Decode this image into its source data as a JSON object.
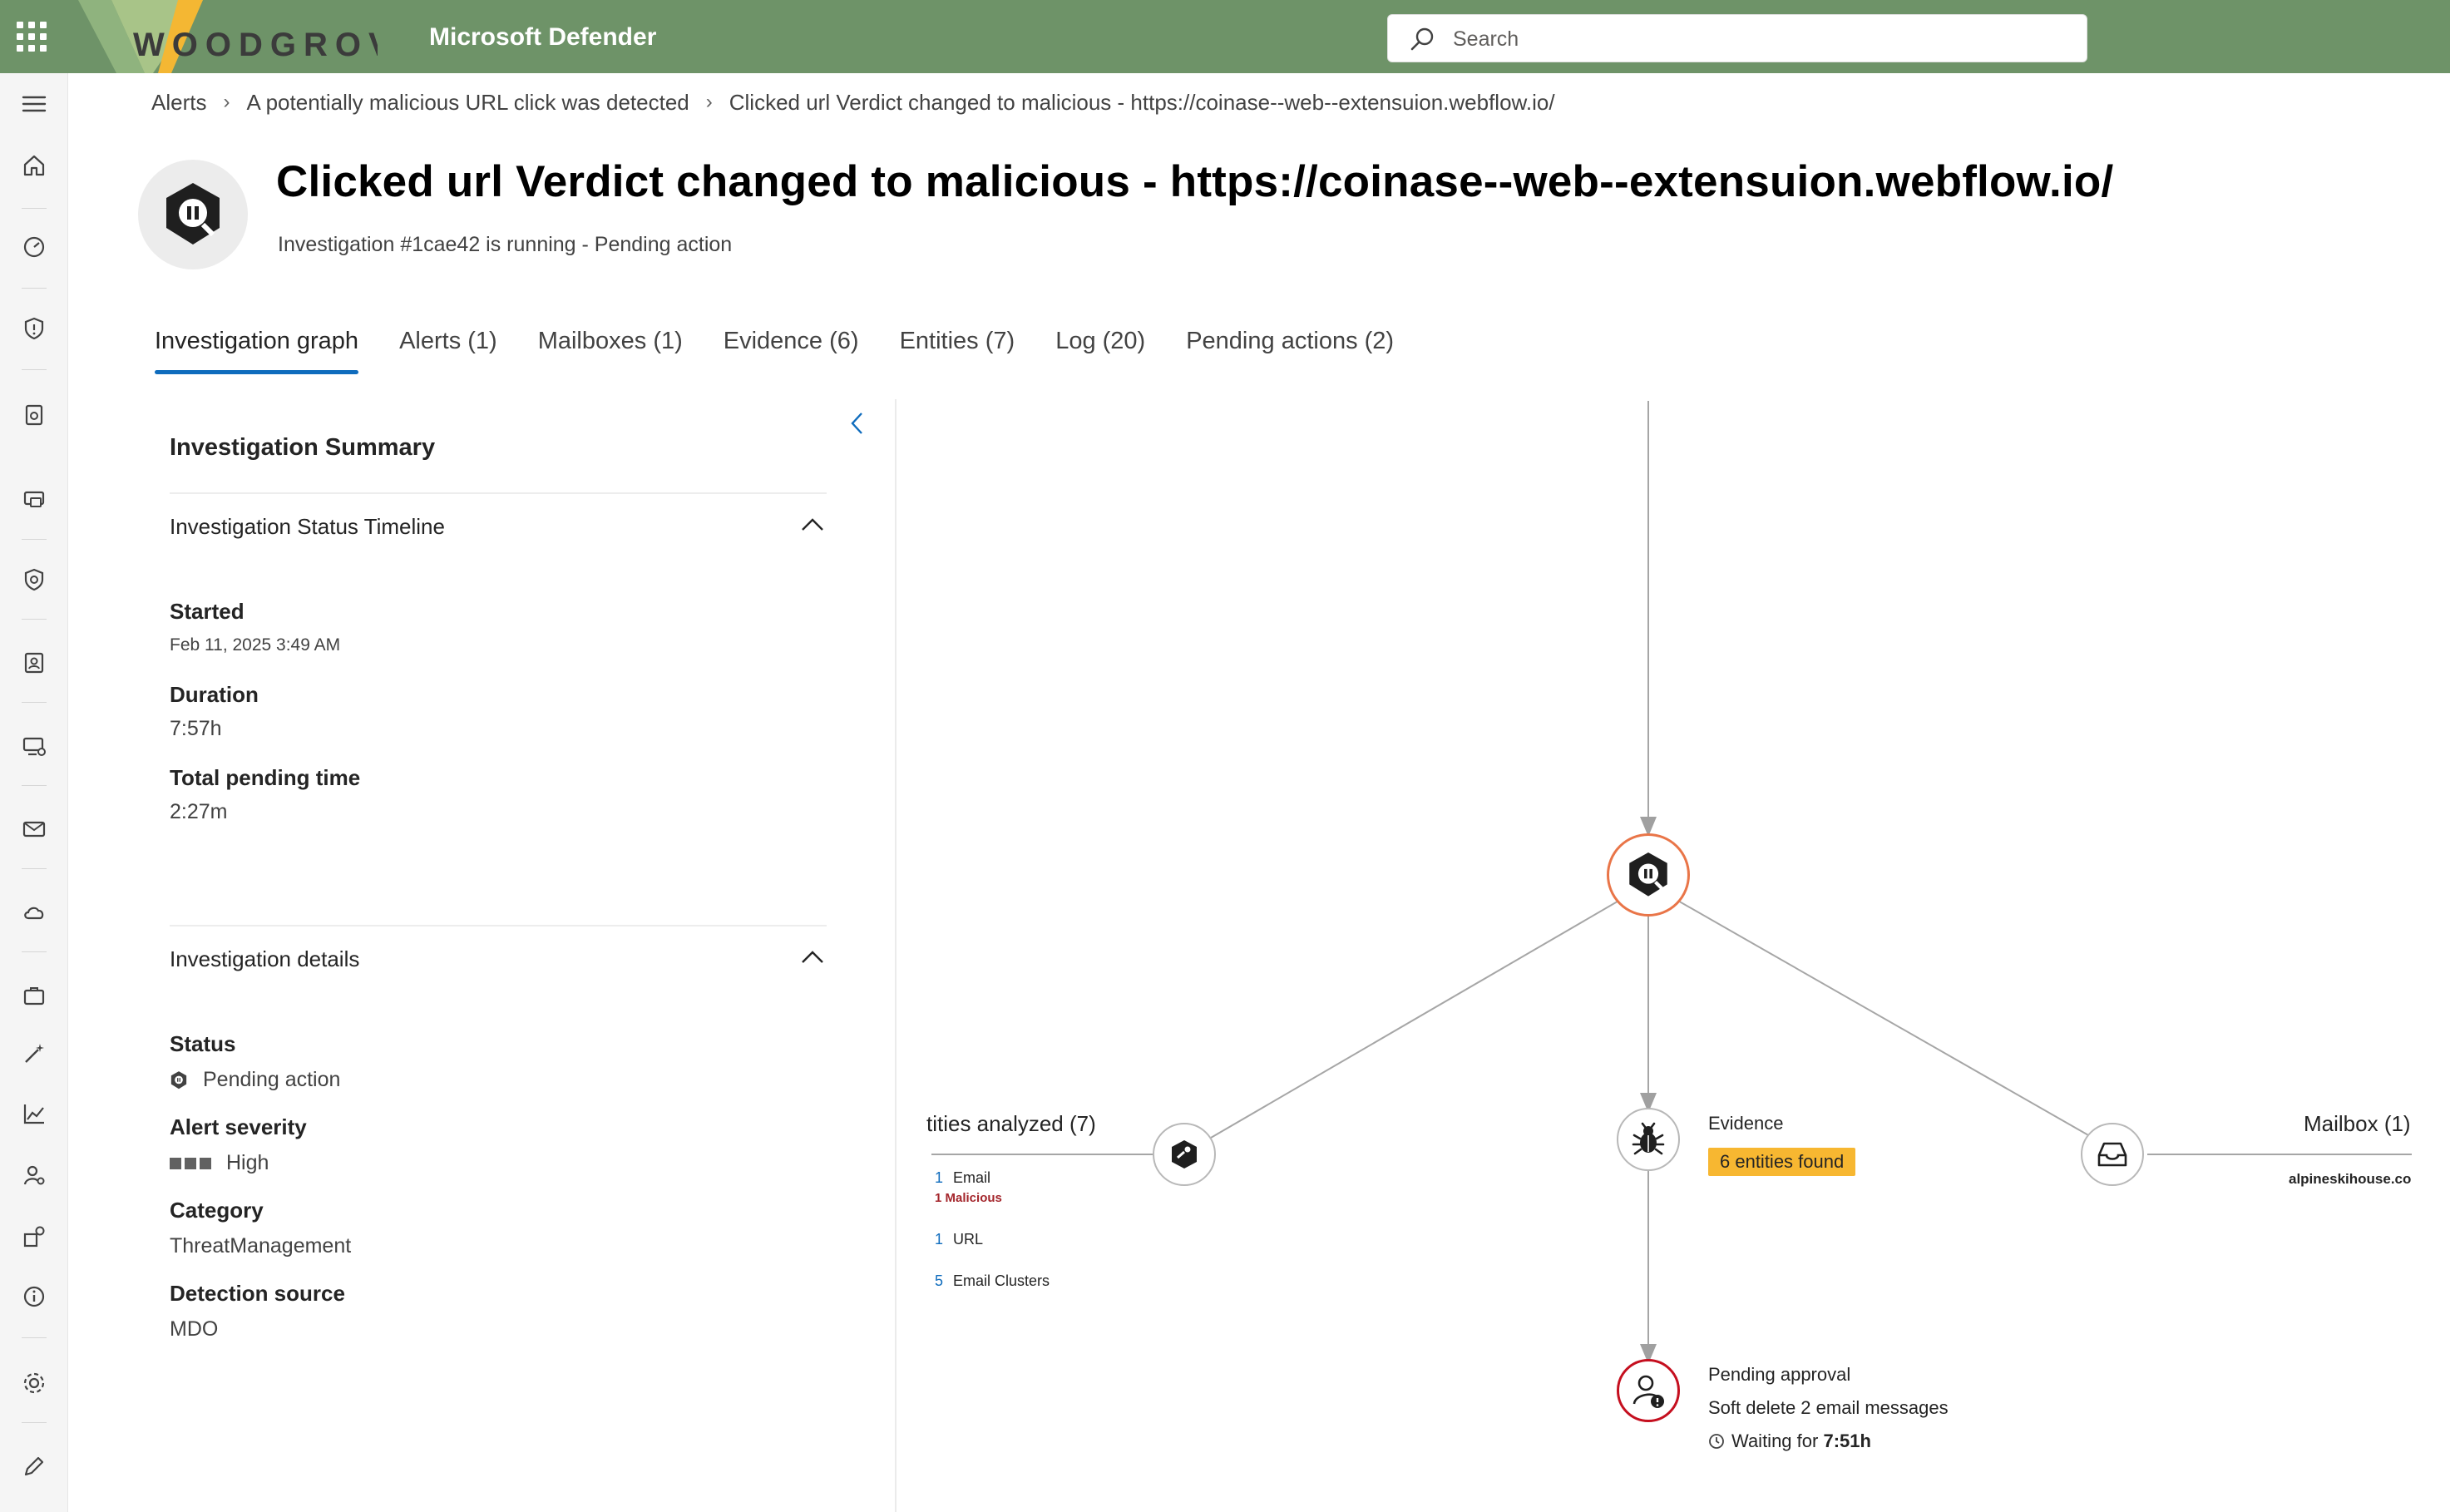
{
  "topbar": {
    "logo_text": "WOODGROVE",
    "product_name": "Microsoft Defender",
    "search_placeholder": "Search"
  },
  "breadcrumb": {
    "items": [
      "Alerts",
      "A potentially malicious URL click was detected",
      "Clicked url Verdict changed to malicious - https://coinase--web--extensuion.webflow.io/"
    ]
  },
  "header": {
    "title": "Clicked url Verdict changed to malicious - https://coinase--web--extensuion.webflow.io/",
    "subtitle": "Investigation #1cae42 is running - Pending action"
  },
  "tabs": [
    {
      "label": "Investigation graph",
      "active": true
    },
    {
      "label": "Alerts (1)",
      "active": false
    },
    {
      "label": "Mailboxes (1)",
      "active": false
    },
    {
      "label": "Evidence (6)",
      "active": false
    },
    {
      "label": "Entities (7)",
      "active": false
    },
    {
      "label": "Log (20)",
      "active": false
    },
    {
      "label": "Pending actions (2)",
      "active": false
    }
  ],
  "summary": {
    "title": "Investigation Summary",
    "timeline": {
      "heading": "Investigation Status Timeline",
      "started_label": "Started",
      "started_value": "Feb 11, 2025 3:49 AM",
      "duration_label": "Duration",
      "duration_value": "7:57h",
      "pending_label": "Total pending time",
      "pending_value": "2:27m"
    },
    "details": {
      "heading": "Investigation details",
      "status_label": "Status",
      "status_value": "Pending action",
      "severity_label": "Alert severity",
      "severity_value": "High",
      "category_label": "Category",
      "category_value": "ThreatManagement",
      "source_label": "Detection source",
      "source_value": "MDO"
    }
  },
  "graph": {
    "entities": {
      "title": "tities analyzed (7)",
      "rows": [
        {
          "count": "1",
          "label": "Email",
          "note": "1 Malicious"
        },
        {
          "count": "1",
          "label": "URL",
          "note": ""
        },
        {
          "count": "5",
          "label": "Email Clusters",
          "note": ""
        }
      ]
    },
    "evidence": {
      "title": "Evidence",
      "badge": "6 entities found"
    },
    "mailbox": {
      "title": "Mailbox (1)",
      "sub": "alpineskihouse.co"
    },
    "pending": {
      "title": "Pending approval",
      "action": "Soft delete 2 email messages",
      "waiting_label": "Waiting for",
      "waiting_value": "7:51h"
    }
  },
  "colors": {
    "topbar": "#6e9368",
    "accent": "#0f6cbd",
    "evidence_badge": "#f7b731",
    "pending_ring": "#c50f1f",
    "investigation_ring": "#e97548",
    "malicious_text": "#a4262c"
  }
}
